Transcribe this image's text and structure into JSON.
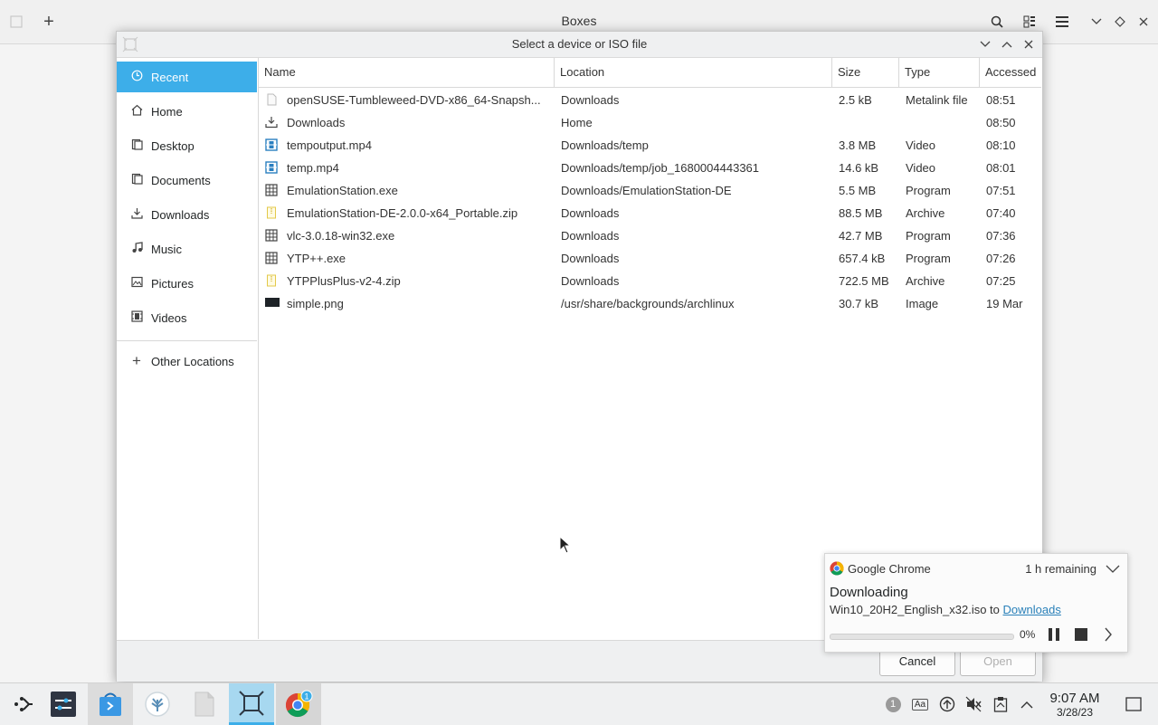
{
  "boxes": {
    "title": "Boxes",
    "icons": [
      "window-menu-icon",
      "add-icon",
      "search-icon",
      "view-icon",
      "hamburger-menu-icon",
      "minimize-icon",
      "maximize-icon",
      "close-icon"
    ]
  },
  "dialog": {
    "title": "Select a device or ISO file",
    "sidebar": [
      {
        "label": "Recent",
        "icon": "clock-icon",
        "active": true
      },
      {
        "label": "Home",
        "icon": "home-icon"
      },
      {
        "label": "Desktop",
        "icon": "desktop-icon"
      },
      {
        "label": "Documents",
        "icon": "documents-icon"
      },
      {
        "label": "Downloads",
        "icon": "downloads-icon"
      },
      {
        "label": "Music",
        "icon": "music-icon"
      },
      {
        "label": "Pictures",
        "icon": "pictures-icon"
      },
      {
        "label": "Videos",
        "icon": "videos-icon"
      }
    ],
    "other_locations": "Other Locations",
    "columns": [
      "Name",
      "Location",
      "Size",
      "Type",
      "Accessed"
    ],
    "files": [
      {
        "name": "openSUSE-Tumbleweed-DVD-x86_64-Snapsh...",
        "location": "Downloads",
        "size": "2.5 kB",
        "type": "Metalink file",
        "accessed": "08:51",
        "icon": "document-icon"
      },
      {
        "name": "Downloads",
        "location": "Home",
        "size": "",
        "type": "",
        "accessed": "08:50",
        "icon": "folder-download-icon"
      },
      {
        "name": "tempoutput.mp4",
        "location": "Downloads/temp",
        "size": "3.8 MB",
        "type": "Video",
        "accessed": "08:10",
        "icon": "video-icon"
      },
      {
        "name": "temp.mp4",
        "location": "Downloads/temp/job_1680004443361",
        "size": "14.6 kB",
        "type": "Video",
        "accessed": "08:01",
        "icon": "video-icon"
      },
      {
        "name": "EmulationStation.exe",
        "location": "Downloads/EmulationStation-DE",
        "size": "5.5 MB",
        "type": "Program",
        "accessed": "07:51",
        "icon": "program-icon"
      },
      {
        "name": "EmulationStation-DE-2.0.0-x64_Portable.zip",
        "location": "Downloads",
        "size": "88.5 MB",
        "type": "Archive",
        "accessed": "07:40",
        "icon": "archive-icon"
      },
      {
        "name": "vlc-3.0.18-win32.exe",
        "location": "Downloads",
        "size": "42.7 MB",
        "type": "Program",
        "accessed": "07:36",
        "icon": "program-icon"
      },
      {
        "name": "YTP++.exe",
        "location": "Downloads",
        "size": "657.4 kB",
        "type": "Program",
        "accessed": "07:26",
        "icon": "program-icon"
      },
      {
        "name": "YTPPlusPlus-v2-4.zip",
        "location": "Downloads",
        "size": "722.5 MB",
        "type": "Archive",
        "accessed": "07:25",
        "icon": "archive-icon"
      },
      {
        "name": "simple.png",
        "location": "/usr/share/backgrounds/archlinux",
        "size": "30.7 kB",
        "type": "Image",
        "accessed": "19 Mar",
        "icon": "image-icon"
      }
    ],
    "cancel_label": "Cancel",
    "open_label": "Open"
  },
  "notification": {
    "app": "Google Chrome",
    "remaining": "1 h remaining",
    "title": "Downloading",
    "file": "Win10_20H2_English_x32.iso to ",
    "link": "Downloads",
    "percent_label": "0%",
    "progress": 0
  },
  "taskbar": {
    "apps": [
      "app-launcher-icon",
      "system-settings-icon",
      "discover-store-icon",
      "kde-connect-icon",
      "file-manager-icon",
      "boxes-icon",
      "chrome-icon"
    ],
    "chrome_badge": "1",
    "tray_badge": "1",
    "tray_text": "Aa",
    "time": "9:07 AM",
    "date": "3/28/23"
  },
  "colors": {
    "accent": "#3daee9",
    "link": "#2980b9"
  }
}
